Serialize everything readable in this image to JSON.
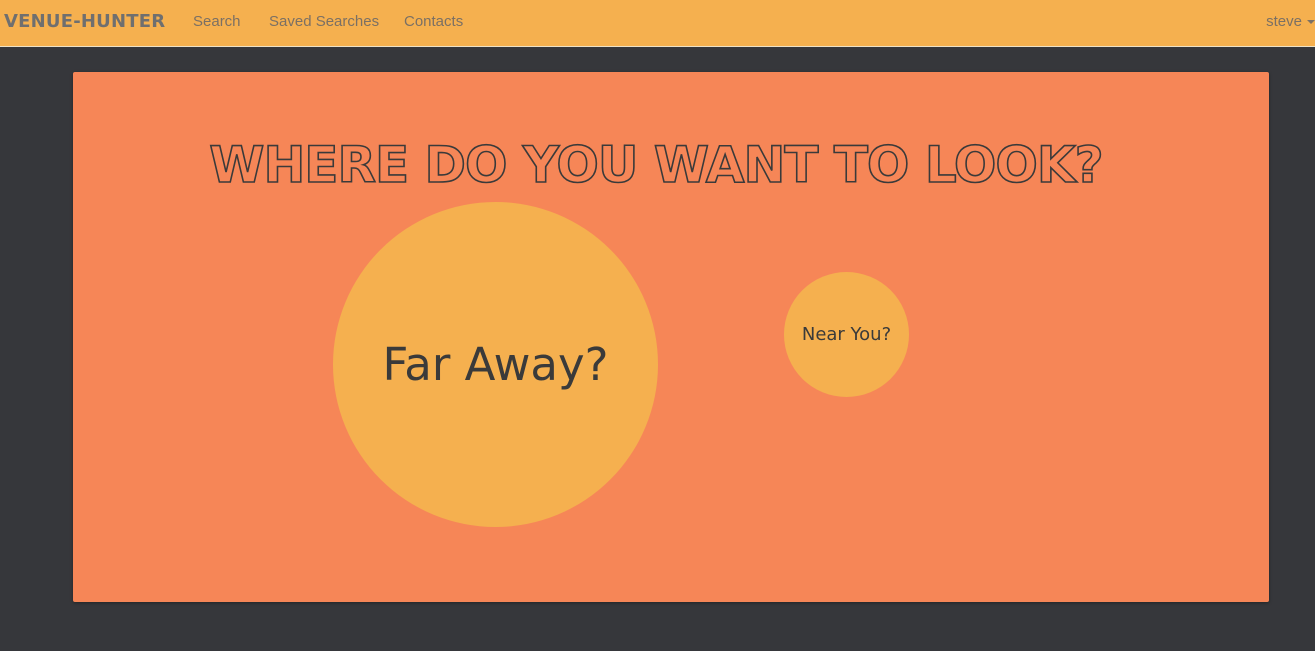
{
  "navbar": {
    "brand": "Venue-Hunter",
    "links": [
      "Search",
      "Saved Searches",
      "Contacts"
    ],
    "user": "steve"
  },
  "main": {
    "heading": "WHERE DO YOU WANT TO LOOK?",
    "options": {
      "far_label": "Far Away?",
      "near_label": "Near You?"
    }
  },
  "colors": {
    "navbar_bg": "#f5b04f",
    "page_bg": "#36373b",
    "panel_bg": "#f68657",
    "circle_bg": "#f5b04f",
    "heading_stroke": "#3a3a3a"
  },
  "icons": {
    "user_menu": "caret-down-icon"
  }
}
